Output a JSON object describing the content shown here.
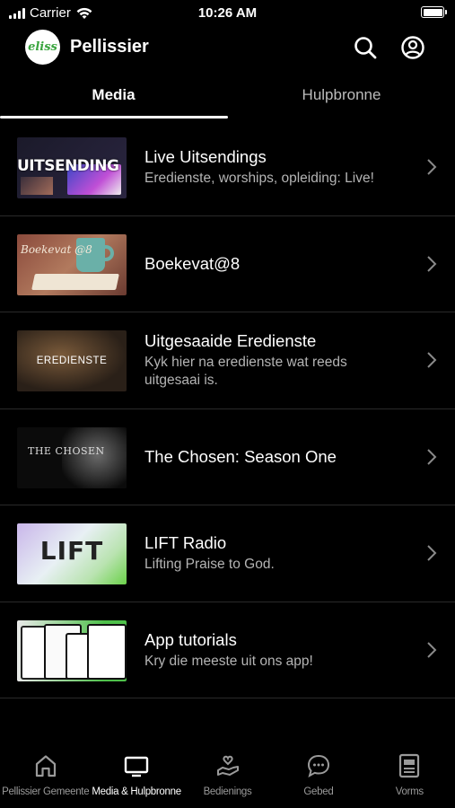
{
  "status_bar": {
    "carrier": "Carrier",
    "time": "10:26 AM"
  },
  "header": {
    "logo_text": "eliss",
    "title": "Pellissier"
  },
  "tabs": [
    {
      "label": "Media",
      "active": true
    },
    {
      "label": "Hulpbronne",
      "active": false
    }
  ],
  "items": [
    {
      "title": "Live Uitsendings",
      "subtitle": "Eredienste, worships, opleiding: Live!",
      "thumb_text": "UITSENDING"
    },
    {
      "title": "Boekevat@8",
      "subtitle": "",
      "thumb_text": "Boekevat @8"
    },
    {
      "title": "Uitgesaaide Eredienste",
      "subtitle": "Kyk hier na eredienste wat reeds uitgesaai is.",
      "thumb_text": "EREDIENSTE"
    },
    {
      "title": "The Chosen: Season One",
      "subtitle": "",
      "thumb_text": "THE CHOSEN"
    },
    {
      "title": "LIFT Radio",
      "subtitle": "Lifting Praise to God.",
      "thumb_text": "LIFT"
    },
    {
      "title": "App tutorials",
      "subtitle": "Kry die meeste uit ons app!",
      "thumb_text": ""
    }
  ],
  "bottom_nav": [
    {
      "label": "Pellissier Gemeente",
      "icon": "home-icon",
      "active": false
    },
    {
      "label": "Media & Hulpbronne",
      "icon": "tv-icon",
      "active": true
    },
    {
      "label": "Bedienings",
      "icon": "hand-heart-icon",
      "active": false
    },
    {
      "label": "Gebed",
      "icon": "chat-bubble-icon",
      "active": false
    },
    {
      "label": "Vorms",
      "icon": "form-icon",
      "active": false
    }
  ],
  "colors": {
    "background": "#000000",
    "text": "#ffffff",
    "muted": "#b4b4b4",
    "brand_green": "#3aa53f"
  }
}
